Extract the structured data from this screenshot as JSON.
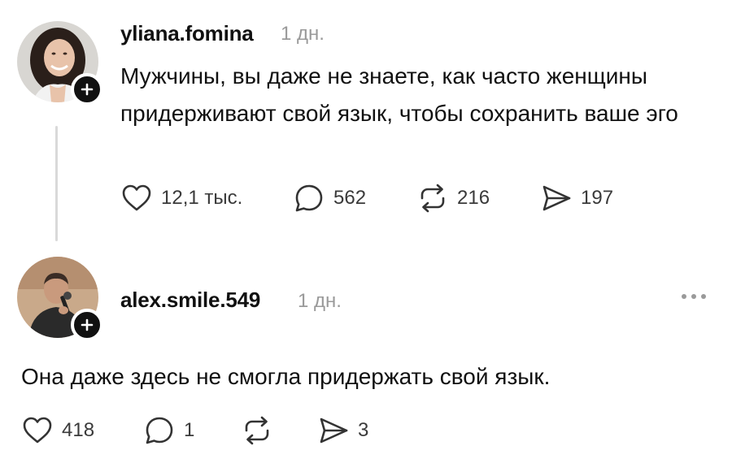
{
  "post": {
    "username": "yliana.fomina",
    "time": "1 дн.",
    "text": "Мужчины, вы даже не знаете, как часто женщины придерживают свой язык, чтобы сохранить ваше эго",
    "likes": "12,1 тыс.",
    "comments": "562",
    "reposts": "216",
    "shares": "197"
  },
  "reply": {
    "username": "alex.smile.549",
    "time": "1 дн.",
    "text": "Она даже здесь не смогла придержать свой язык.",
    "likes": "418",
    "comments": "1",
    "shares": "3"
  },
  "icons": {
    "like": "heart-icon",
    "comment": "speech-bubble-icon",
    "repost": "repost-arrows-icon",
    "share": "paper-plane-icon",
    "follow": "plus-icon",
    "more": "more-dots-icon"
  },
  "colors": {
    "text": "#111111",
    "muted": "#9a9a9a",
    "badge": "#111111"
  }
}
